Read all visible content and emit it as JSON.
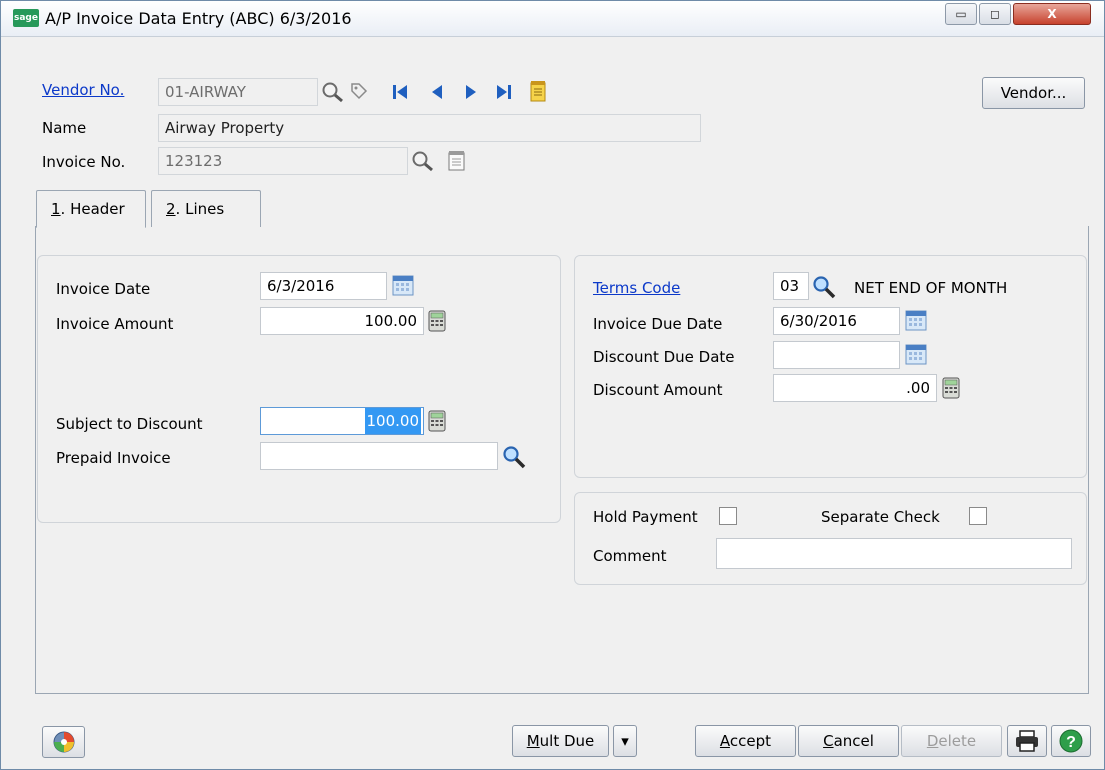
{
  "window": {
    "logo_text": "sage",
    "title": "A/P Invoice Data Entry (ABC) 6/3/2016",
    "min_glyph": "▭",
    "max_glyph": "◻",
    "close_glyph": "X"
  },
  "header": {
    "vendor_no_label": "Vendor No.",
    "vendor_no_value": "01-AIRWAY",
    "name_label": "Name",
    "name_value": "Airway Property",
    "invoice_no_label": "Invoice No.",
    "invoice_no_value": "123123",
    "vendor_button_label": "Vendor..."
  },
  "tabs": [
    {
      "accel": "1",
      "label": ". Header"
    },
    {
      "accel": "2",
      "label": ". Lines"
    }
  ],
  "left_panel": {
    "invoice_date_label": "Invoice Date",
    "invoice_date_value": "6/3/2016",
    "invoice_amount_label": "Invoice Amount",
    "invoice_amount_value": "100.00",
    "subject_to_discount_label": "Subject to Discount",
    "subject_to_discount_value": "100.00",
    "prepaid_invoice_label": "Prepaid Invoice",
    "prepaid_invoice_value": ""
  },
  "right_panel": {
    "terms_code_label": "Terms Code",
    "terms_code_value": "03",
    "terms_description": "NET END OF MONTH",
    "invoice_due_date_label": "Invoice Due Date",
    "invoice_due_date_value": "6/30/2016",
    "discount_due_date_label": "Discount Due Date",
    "discount_due_date_value": "",
    "discount_amount_label": "Discount Amount",
    "discount_amount_value": ".00"
  },
  "options_panel": {
    "hold_payment_label": "Hold Payment",
    "separate_check_label": "Separate Check",
    "comment_label": "Comment",
    "comment_value": ""
  },
  "footer": {
    "mult_due_accel": "M",
    "mult_due_rest": "ult Due",
    "accept_accel": "A",
    "accept_rest": "ccept",
    "cancel_accel": "C",
    "cancel_rest": "ancel",
    "delete_accel": "D",
    "delete_rest": "elete",
    "dropdown_glyph": "▾"
  },
  "colors": {
    "link": "#0c39c9",
    "selection": "#3398f3",
    "brand": "#27995a"
  }
}
